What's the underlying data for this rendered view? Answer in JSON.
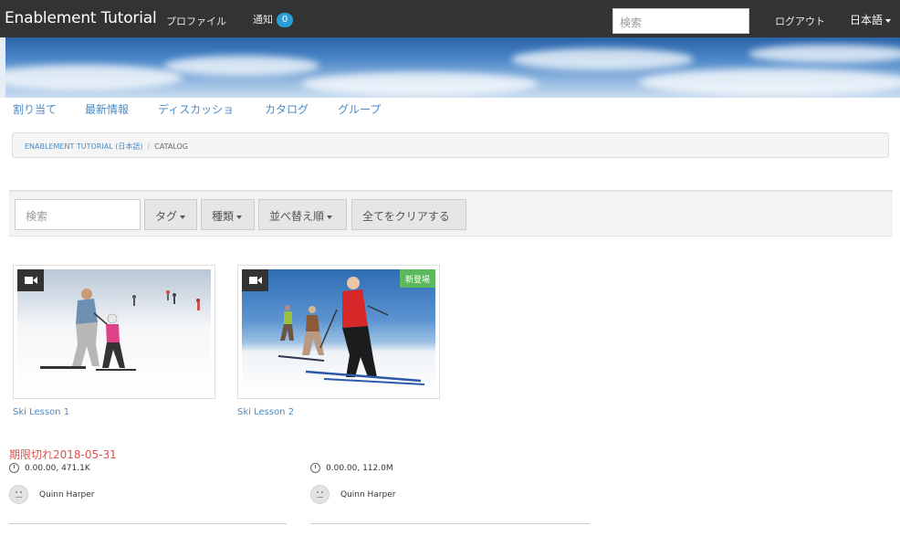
{
  "header": {
    "brand": "Enablement Tutorial",
    "profile_label": "プロファイル",
    "notifications_label": "通知",
    "notifications_count": "0",
    "search_placeholder": "検索",
    "logout_label": "ログアウト",
    "language_label": "日本語"
  },
  "subnav": {
    "items": [
      "割り当て",
      "最新情報",
      "ディスカッショ",
      "カタログ",
      "グループ"
    ]
  },
  "breadcrumb": {
    "parent": "ENABLEMENT TUTORIAL (日本語)",
    "separator": "/",
    "current": "CATALOG"
  },
  "filters": {
    "search_placeholder": "検索",
    "tag_label": "タグ",
    "type_label": "種類",
    "sort_label": "並べ替え順",
    "clear_label": "全てをクリアする"
  },
  "cards": [
    {
      "title": "Ski Lesson 1",
      "type_icon": "video-camera-icon",
      "badge": "",
      "expired_label": "期限切れ2018-05-31",
      "duration": "0.00.00, 471.1K",
      "author": "Quinn Harper"
    },
    {
      "title": "Ski Lesson 2",
      "type_icon": "video-camera-icon",
      "badge": "新登場",
      "duration": "0.00.00, 112.0M",
      "author": "Quinn Harper"
    }
  ],
  "colors": {
    "topbar": "#333333",
    "link": "#4a8ac4",
    "badge": "#2a9fd6",
    "new_badge": "#5cb85c",
    "expired": "#d9534f"
  }
}
